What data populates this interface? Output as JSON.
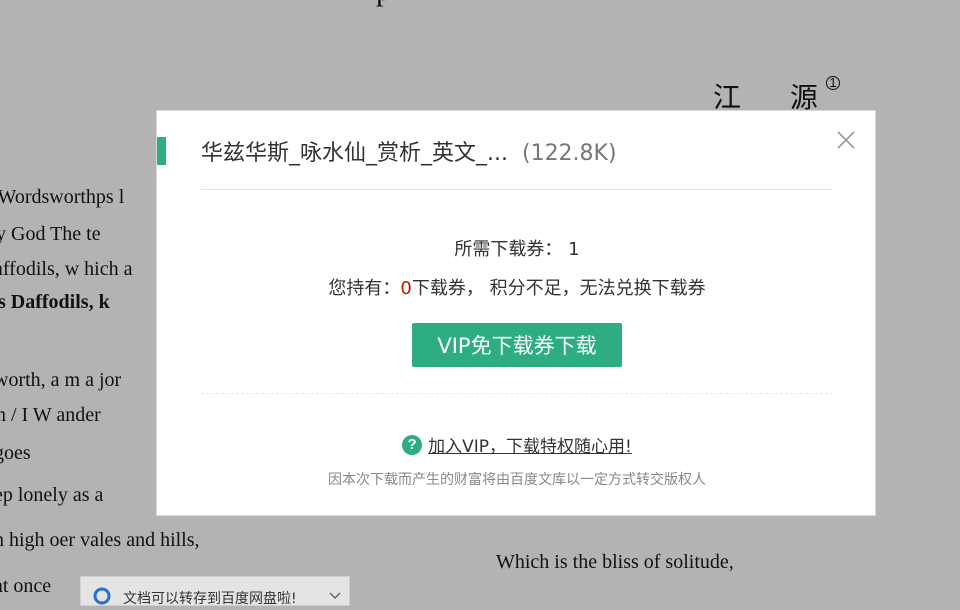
{
  "background_doc": {
    "title_fragment": "p",
    "author": "江 源",
    "footnote_mark": "1",
    "lines": [
      "tWordsworthps l",
      "y God  The te",
      "affodils, w hich  a",
      "s  Daffodils, k",
      "worth,  a m a jor",
      "n  / I W ander",
      "goes",
      "ep lonely as a",
      "n high oer vales and hills,",
      "at once"
    ],
    "right_line": "Which  is the bliss of  solitude,"
  },
  "toast": {
    "text": "文档可以转存到百度网盘啦!",
    "icon": "cloud-icon"
  },
  "modal": {
    "title": "华兹华斯_咏水仙_赏析_英文_...",
    "file_size": "(122.8K)",
    "required_label": "所需下载券：  1",
    "holding_prefix": "您持有：",
    "holding_count": "0",
    "holding_suffix": "下载券，  积分不足，无法兑换下载券",
    "vip_button": "VIP免下载券下载",
    "join_link": "加入VIP，下载特权随心用!",
    "notice": "因本次下载而产生的财富将由百度文库以一定方式转交版权人",
    "accent_color": "#2eae80",
    "zero_color": "#cc1100"
  }
}
